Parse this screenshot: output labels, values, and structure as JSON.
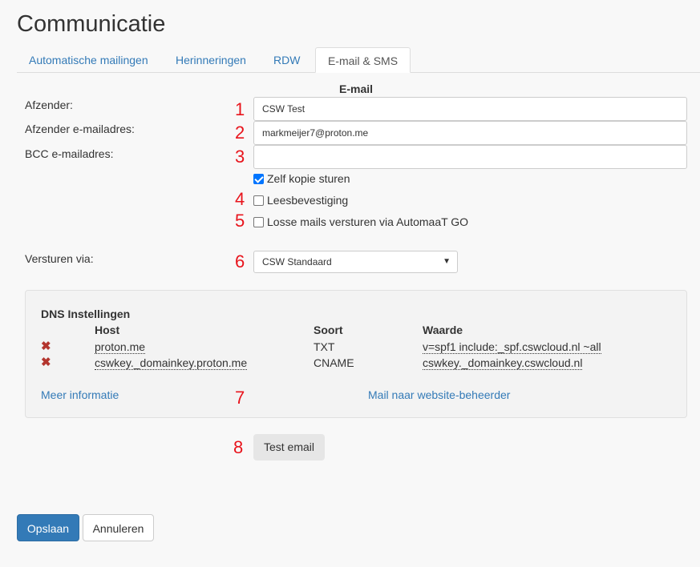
{
  "page": {
    "title": "Communicatie"
  },
  "tabs": [
    {
      "label": "Automatische mailingen",
      "active": false
    },
    {
      "label": "Herinneringen",
      "active": false
    },
    {
      "label": "RDW",
      "active": false
    },
    {
      "label": "E-mail & SMS",
      "active": true
    }
  ],
  "email": {
    "heading": "E-mail",
    "sender_label": "Afzender:",
    "sender_value": "CSW Test",
    "sender_email_label": "Afzender e-mailadres:",
    "sender_email_value": "markmeijer7@proton.me",
    "bcc_label": "BCC e-mailadres:",
    "bcc_value": "",
    "copy_self_label": "Zelf kopie sturen",
    "copy_self_checked": true,
    "read_receipt_label": "Leesbevestiging",
    "read_receipt_checked": false,
    "separate_mails_label": "Losse mails versturen via AutomaaT GO",
    "separate_mails_checked": false,
    "send_via_label": "Versturen via:",
    "send_via_value": "CSW Standaard"
  },
  "dns": {
    "title": "DNS Instellingen",
    "headers": {
      "host": "Host",
      "type": "Soort",
      "value": "Waarde"
    },
    "rows": [
      {
        "host": "proton.me",
        "type": "TXT",
        "value": "v=spf1 include:_spf.cswcloud.nl ~all"
      },
      {
        "host": "cswkey._domainkey.proton.me",
        "type": "CNAME",
        "value": "cswkey._domainkey.cswcloud.nl"
      }
    ],
    "more_info_link": "Meer informatie",
    "mail_admin_link": "Mail naar website-beheerder"
  },
  "buttons": {
    "test_email": "Test email",
    "save": "Opslaan",
    "cancel": "Annuleren"
  },
  "annotations": [
    "1",
    "2",
    "3",
    "4",
    "5",
    "6",
    "7",
    "8"
  ],
  "colors": {
    "link": "#337ab7",
    "annotation": "#e8141c",
    "error_icon": "#b3352e",
    "primary": "#337ab7"
  },
  "icons": {
    "row_status": "cross-icon"
  }
}
